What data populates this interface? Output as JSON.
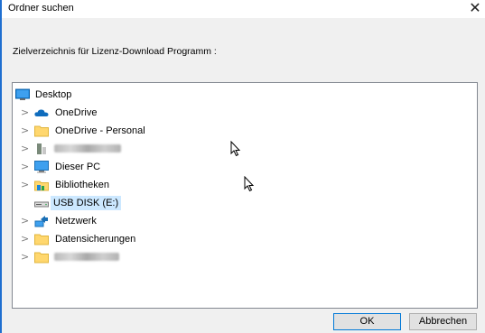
{
  "window": {
    "title": "Ordner suchen",
    "close_glyph": "✕"
  },
  "instruction": "Zielverzeichnis für Lizenz-Download Programm :",
  "tree": {
    "items": [
      {
        "label": "Desktop",
        "icon": "desktop-icon"
      },
      {
        "label": "OneDrive",
        "icon": "cloud-icon"
      },
      {
        "label": "OneDrive - Personal",
        "icon": "folder-icon"
      },
      {
        "label": "",
        "icon": "user-folder-icon",
        "redacted": true
      },
      {
        "label": "Dieser PC",
        "icon": "computer-icon"
      },
      {
        "label": "Bibliotheken",
        "icon": "libraries-icon"
      },
      {
        "label": "USB DISK (E:)",
        "icon": "usb-drive-icon",
        "selected": true
      },
      {
        "label": "Netzwerk",
        "icon": "network-icon"
      },
      {
        "label": "Datensicherungen",
        "icon": "folder-icon"
      },
      {
        "label": "",
        "icon": "folder-icon",
        "redacted": true
      }
    ]
  },
  "buttons": {
    "ok": "OK",
    "cancel": "Abbrechen"
  },
  "colors": {
    "accent": "#0078d7",
    "selection": "#cce8ff",
    "folder": "#ffd76e"
  }
}
